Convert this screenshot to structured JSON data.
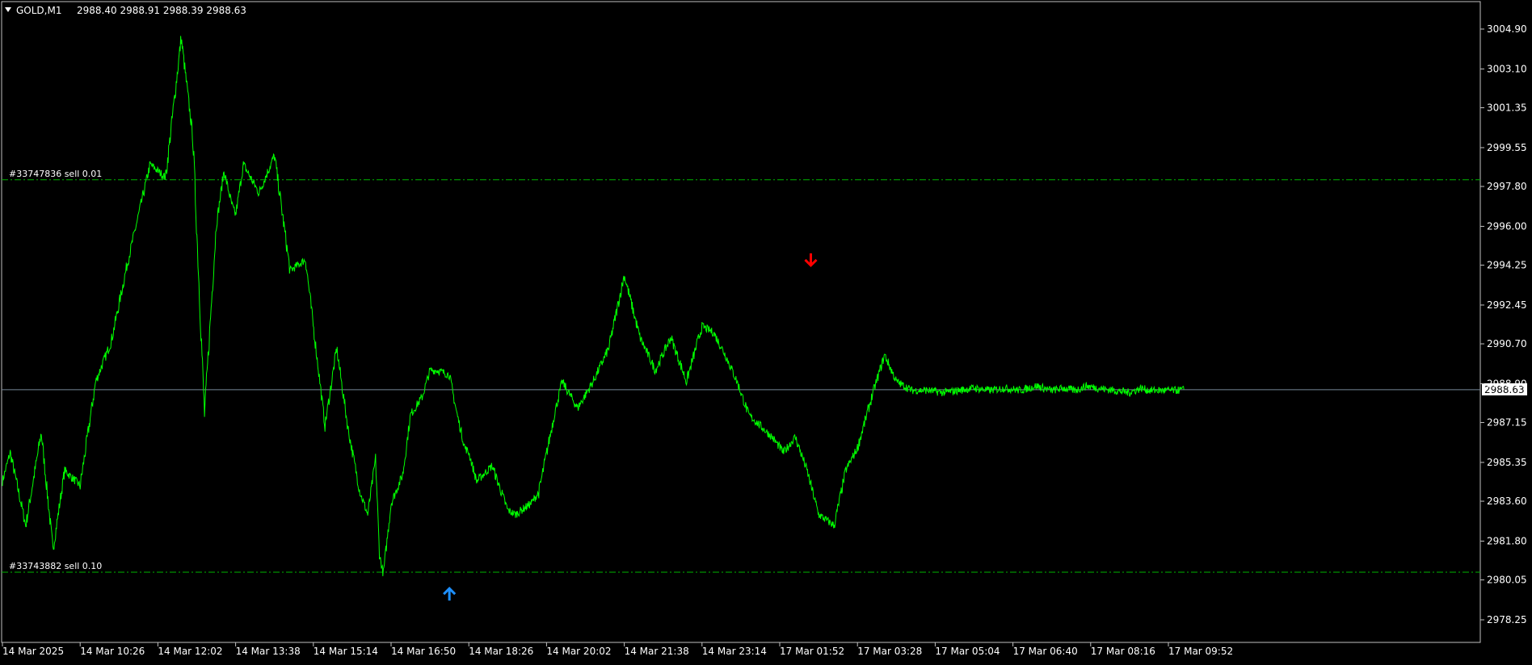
{
  "header": {
    "menu_icon": "triangle-down-icon",
    "symbol": "GOLD,M1",
    "ohlc": "2988.40 2988.91 2988.39 2988.63"
  },
  "colors": {
    "background": "#000000",
    "frame": "#c0c0c0",
    "price_line": "#00ff00",
    "order_line": "#00b400",
    "bid_line": "#778899",
    "buy_arrow": "#1e90ff",
    "sell_arrow": "#ff0000",
    "text": "#ffffff"
  },
  "chart_data": {
    "type": "line",
    "symbol": "GOLD",
    "timeframe": "M1",
    "ylim": [
      2977.8,
      3006.3
    ],
    "y_ticks": [
      "3004.90",
      "3003.10",
      "3001.35",
      "2999.55",
      "2997.80",
      "2996.00",
      "2994.25",
      "2992.45",
      "2990.70",
      "2988.90",
      "2987.15",
      "2985.35",
      "2983.60",
      "2981.80",
      "2980.05",
      "2978.25"
    ],
    "x_ticks": [
      "14 Mar 2025",
      "14 Mar 10:26",
      "14 Mar 12:02",
      "14 Mar 13:38",
      "14 Mar 15:14",
      "14 Mar 16:50",
      "14 Mar 18:26",
      "14 Mar 20:02",
      "14 Mar 21:38",
      "14 Mar 23:14",
      "17 Mar 01:52",
      "17 Mar 03:28",
      "17 Mar 05:04",
      "17 Mar 06:40",
      "17 Mar 08:16",
      "17 Mar 09:52"
    ],
    "x_tick_index": [
      0,
      1,
      2,
      3,
      4,
      5,
      6,
      7,
      8,
      9,
      10,
      11,
      12,
      13,
      14,
      15
    ],
    "x_max_index": 19.6,
    "series": [
      {
        "x": [
          0,
          0.1,
          0.3,
          0.5,
          0.65,
          0.8,
          1.0,
          1.2,
          1.4,
          1.6,
          1.75,
          1.9,
          2.1,
          2.3,
          2.45,
          2.6,
          2.75,
          2.85,
          2.95,
          3.0,
          3.1,
          3.3,
          3.5,
          3.7,
          3.9,
          4.05,
          4.15,
          4.3,
          4.45,
          4.6,
          4.7,
          4.8,
          4.85,
          4.9,
          5.0,
          5.15,
          5.25,
          5.4,
          5.5,
          5.6,
          5.75,
          5.85,
          5.95,
          6.0,
          6.1,
          6.3,
          6.5,
          6.6,
          6.8,
          6.9,
          7.1,
          7.2,
          7.4,
          7.6,
          7.8,
          8.0,
          8.2,
          8.4,
          8.6,
          8.8,
          9.0,
          9.15,
          9.3,
          9.45,
          9.6,
          9.75,
          9.9,
          10.05,
          10.2,
          10.35,
          10.5,
          10.7,
          10.85,
          11.0,
          11.2,
          11.35,
          11.5,
          11.7,
          11.9,
          12.1,
          12.3,
          12.5,
          12.7,
          12.9,
          13.1,
          13.3,
          13.5,
          13.65,
          13.8,
          13.95,
          14.1,
          14.3,
          14.5,
          14.65,
          14.75,
          14.85,
          15.0,
          15.1,
          15.2
        ],
        "close": [
          2984.5,
          2985.8,
          2982.5,
          2986.7,
          2981.4,
          2985.0,
          2984.3,
          2989.0,
          2990.8,
          2994.2,
          2996.5,
          2998.8,
          2998.2,
          3004.5,
          3000.0,
          2987.5,
          2996.0,
          2998.5,
          2997.0,
          2996.5,
          2998.8,
          2997.5,
          2999.2,
          2994.0,
          2994.5,
          2990.0,
          2987.0,
          2990.5,
          2986.8,
          2984.0,
          2983.0,
          2985.5,
          2981.2,
          2980.3,
          2983.5,
          2984.8,
          2987.5,
          2988.3,
          2989.5,
          2989.5,
          2989.3,
          2987.5,
          2986.0,
          2985.8,
          2984.5,
          2985.2,
          2983.2,
          2983.0,
          2983.5,
          2984.0,
          2987.5,
          2989.0,
          2987.8,
          2989.0,
          2990.5,
          2993.8,
          2991.0,
          2989.5,
          2991.0,
          2989.0,
          2991.5,
          2991.2,
          2990.2,
          2989.0,
          2987.5,
          2987.0,
          2986.5,
          2985.8,
          2986.5,
          2985.0,
          2983.0,
          2982.5,
          2985.0,
          2986.0,
          2988.5,
          2990.2,
          2989.0,
          2988.6,
          2988.6,
          2988.5,
          2988.6,
          2988.7,
          2988.6,
          2988.7,
          2988.6,
          2988.8,
          2988.6,
          2988.7,
          2988.6,
          2988.8,
          2988.7,
          2988.6,
          2988.5,
          2988.7,
          2988.6,
          2988.6,
          2988.6,
          2988.6,
          2988.63
        ]
      }
    ],
    "current_price": "2988.63",
    "order_lines": [
      {
        "label": "#33747836 sell 0.01",
        "price": 2998.1
      },
      {
        "label": "#33743882 sell 0.10",
        "price": 2980.4
      }
    ],
    "markers": [
      {
        "type": "buy-arrow",
        "x_index": 5.75,
        "price": 2979.7
      },
      {
        "type": "sell-arrow",
        "x_index": 10.4,
        "price": 2994.2
      }
    ]
  }
}
